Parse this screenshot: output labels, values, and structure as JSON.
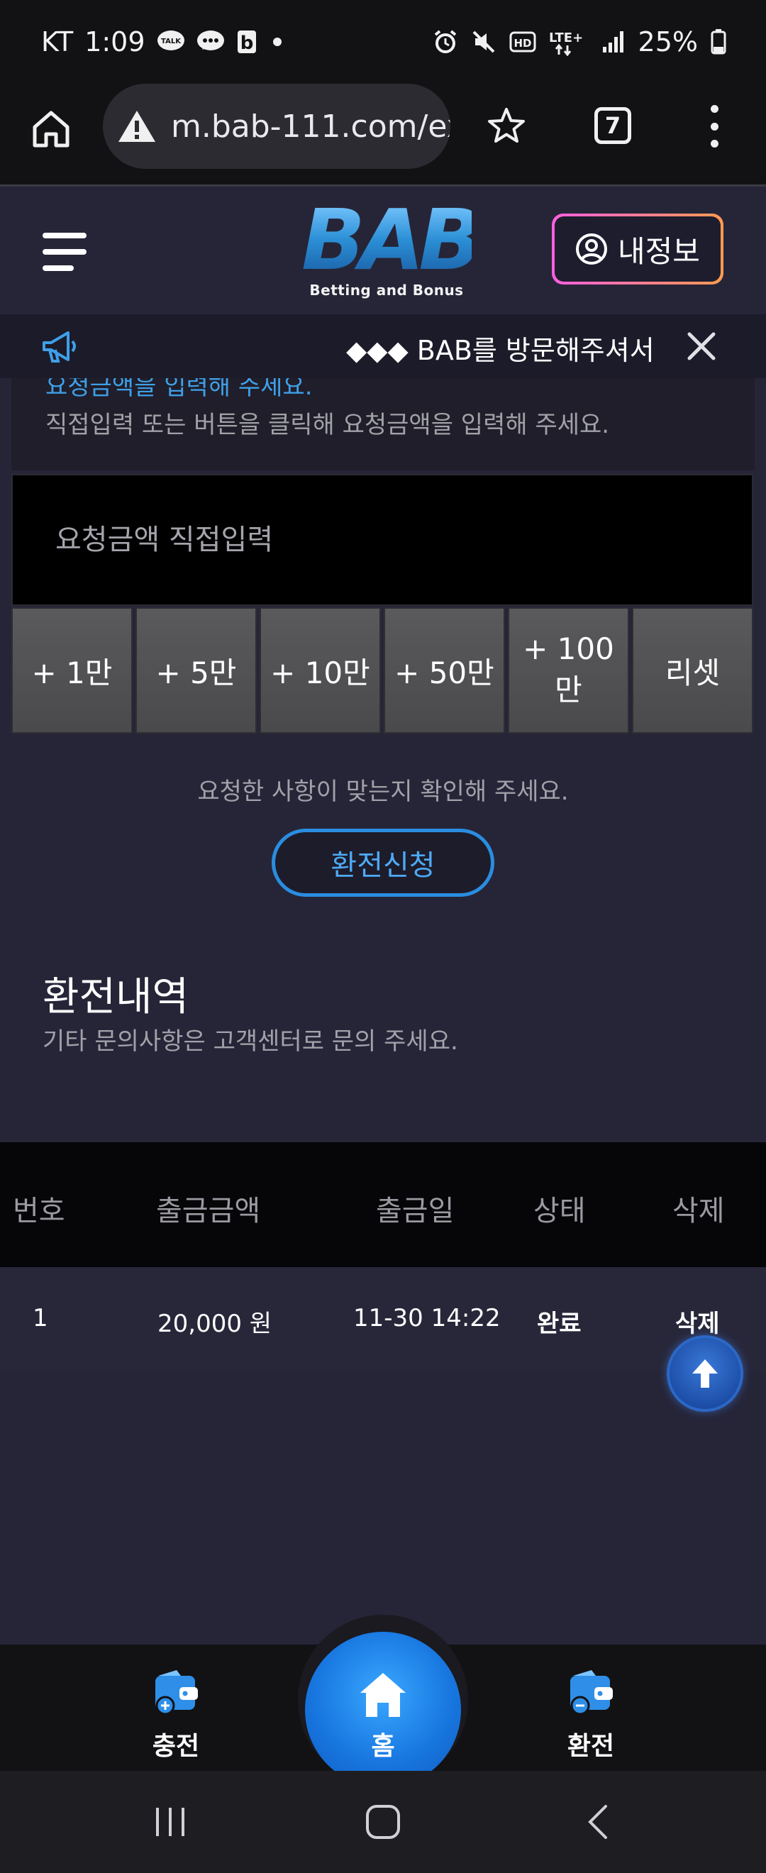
{
  "status_bar": {
    "carrier": "KT",
    "time": "1:09",
    "battery": "25%"
  },
  "browser": {
    "url": "m.bab-111.com/ex",
    "tab_count": "7"
  },
  "header": {
    "logo_text": "BAB",
    "logo_sub": "Betting and Bonus",
    "myinfo_label": "내정보"
  },
  "notice": {
    "text": "◆◆◆ BAB를 방문해주셔서 감사"
  },
  "exchange": {
    "guide_blue": "요청금액을 입력해 주세요.",
    "guide_gray": "직접입력 또는 버튼을 클릭해 요청금액을 입력해 주세요.",
    "amount_placeholder": "요청금액 직접입력",
    "quick_buttons": [
      "+ 1만",
      "+ 5만",
      "+ 10만",
      "+ 50만",
      "+ 100만",
      "리셋"
    ],
    "confirm_text": "요청한 사항이 맞는지 확인해 주세요.",
    "apply_label": "환전신청"
  },
  "history": {
    "title": "환전내역",
    "subtitle": "기타 문의사항은 고객센터로 문의 주세요.",
    "columns": [
      "번호",
      "출금금액",
      "출금일",
      "상태",
      "삭제"
    ],
    "rows": [
      {
        "no": "1",
        "amount": "20,000 원",
        "date": "11-30 14:22",
        "status": "완료",
        "delete": "삭제"
      }
    ]
  },
  "bottom_nav": {
    "charge_label": "충전",
    "home_label": "홈",
    "exchange_label": "환전"
  },
  "colors": {
    "accent_blue": "#2a8de0",
    "page_bg": "#262538"
  }
}
